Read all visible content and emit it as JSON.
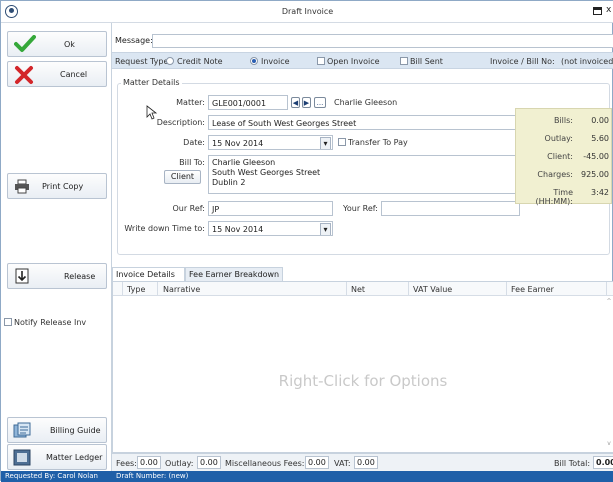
{
  "window": {
    "title": "Draft Invoice"
  },
  "left_buttons": {
    "ok": "Ok",
    "cancel": "Cancel",
    "print_copy": "Print Copy",
    "release": "Release",
    "notify_release": "Notify Release Inv",
    "billing_guide": "Billing Guide",
    "matter_ledger": "Matter Ledger"
  },
  "message": {
    "label": "Message:",
    "value": ""
  },
  "request_type": {
    "label": "Request Type:",
    "options": [
      "Credit Note",
      "Invoice"
    ],
    "selected": "Invoice",
    "open_invoice": "Open Invoice",
    "bill_sent": "Bill Sent",
    "invoice_no_label": "Invoice / Bill No:",
    "invoice_no_value": "(not invoiced"
  },
  "matter": {
    "group_title": "Matter Details",
    "matter_label": "Matter:",
    "matter_value": "GLE001/0001",
    "client_name": "Charlie Gleeson",
    "description_label": "Description:",
    "description_value": "Lease of South West Georges Street",
    "date_label": "Date:",
    "date_value": "15 Nov 2014",
    "transfer_to_pay": "Transfer To Pay",
    "bill_to_label": "Bill To:",
    "client_button": "Client",
    "bill_to_lines": [
      "Charlie Gleeson",
      "South West Georges Street",
      "Dublin 2"
    ],
    "our_ref_label": "Our Ref:",
    "our_ref_value": "JP",
    "your_ref_label": "Your Ref:",
    "your_ref_value": "",
    "write_down_label": "Write down Time to:",
    "write_down_value": "15 Nov 2014",
    "ellipsis": "..."
  },
  "summary": {
    "items": [
      {
        "label": "Bills:",
        "value": "0.00"
      },
      {
        "label": "Outlay:",
        "value": "5.60"
      },
      {
        "label": "Client:",
        "value": "-45.00"
      },
      {
        "label": "Charges:",
        "value": "925.00"
      },
      {
        "label": "Time (HH:MM):",
        "value": "3:42"
      }
    ]
  },
  "tabs": [
    "Invoice Details",
    "Fee Earner Breakdown"
  ],
  "grid": {
    "columns": [
      "Type",
      "Narrative",
      "Net",
      "VAT Value",
      "Fee Earner"
    ],
    "hint": "Right-Click for Options"
  },
  "footer": {
    "fees_label": "Fees:",
    "fees_value": "0.00",
    "outlay_label": "Outlay:",
    "outlay_value": "0.00",
    "misc_label": "Miscellaneous Fees:",
    "misc_value": "0.00",
    "vat_label": "VAT:",
    "vat_value": "0.00",
    "total_label": "Bill Total:",
    "total_value": "0.00"
  },
  "status": {
    "requested_by": "Requested By: Carol Nolan",
    "draft_number": "Draft Number: (new)"
  },
  "colors": {
    "status_bar": "#1f5fa8",
    "summary_bg": "#f1f0d1",
    "request_bar": "#dbe6f2"
  }
}
